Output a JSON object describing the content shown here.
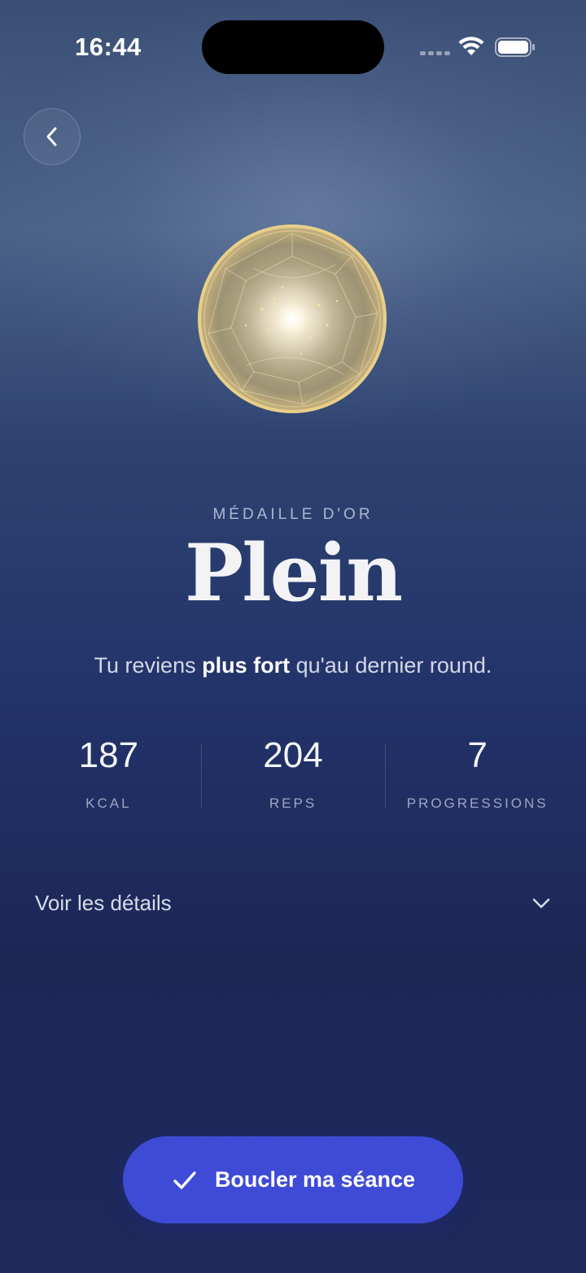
{
  "status_bar": {
    "time": "16:44"
  },
  "header": {
    "back_icon": "chevron-left-icon"
  },
  "medal": {
    "kicker": "MÉDAILLE D'OR",
    "title": "Plein",
    "icon": "gold-medal-icon"
  },
  "subtitle": {
    "before": "Tu reviens ",
    "bold": "plus fort",
    "after": " qu'au dernier round."
  },
  "stats": [
    {
      "value": "187",
      "label": "KCAL"
    },
    {
      "value": "204",
      "label": "REPS"
    },
    {
      "value": "7",
      "label": "PROGRESSIONS"
    }
  ],
  "details": {
    "label": "Voir les détails",
    "icon": "chevron-down-icon"
  },
  "cta": {
    "label": "Boucler ma séance",
    "icon": "checkmark-icon",
    "color": "#3f4bd6"
  }
}
